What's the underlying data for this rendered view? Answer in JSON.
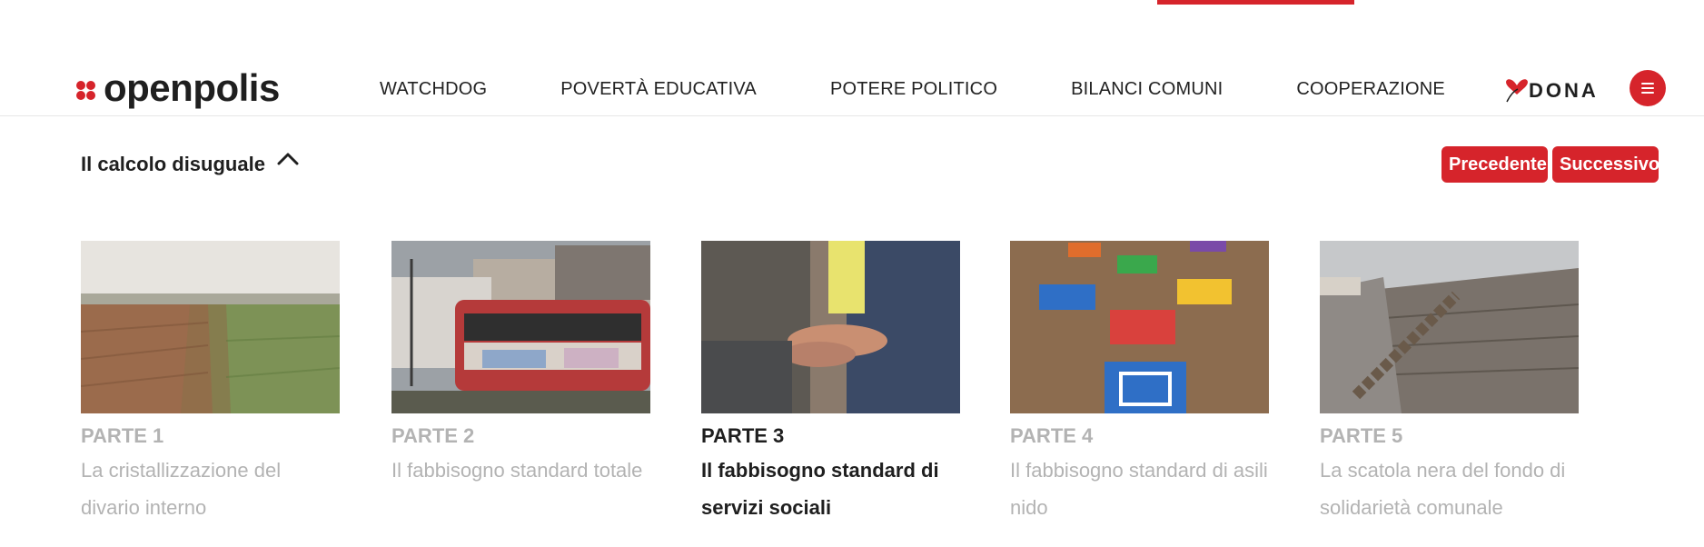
{
  "header": {
    "logo_text": "openpolis",
    "nav": [
      {
        "label": "WATCHDOG"
      },
      {
        "label": "POVERTÀ EDUCATIVA"
      },
      {
        "label": "POTERE POLITICO"
      },
      {
        "label": "BILANCI COMUNI"
      },
      {
        "label": "COOPERAZIONE"
      }
    ],
    "donate_label": "DONA",
    "menu_icon": "hamburger-icon"
  },
  "series": {
    "title": "Il calcolo disuguale",
    "toggle_icon": "chevron-up-icon",
    "prev_label": "Precedente",
    "next_label": "Successivo"
  },
  "parts": [
    {
      "label": "PARTE 1",
      "title": "La cristallizzazione del divario interno",
      "image": "plowed-field-and-grass-photo",
      "active": false
    },
    {
      "label": "PARTE 2",
      "title": "Il fabbisogno standard totale",
      "image": "train-with-graffiti-photo",
      "active": false
    },
    {
      "label": "PARTE 3",
      "title": "Il fabbisogno standard di servizi sociali",
      "image": "helping-hands-photo",
      "active": true
    },
    {
      "label": "PARTE 4",
      "title": "Il fabbisogno standard di asili nido",
      "image": "hopscotch-tiles-photo",
      "active": false
    },
    {
      "label": "PARTE 5",
      "title": "La scatola nera del fondo di solidarietà comunale",
      "image": "chain-on-wooden-dock-photo",
      "active": false
    }
  ],
  "colors": {
    "accent": "#d6242b",
    "muted_text": "#b3b3b3",
    "text": "#1f1f1f"
  }
}
